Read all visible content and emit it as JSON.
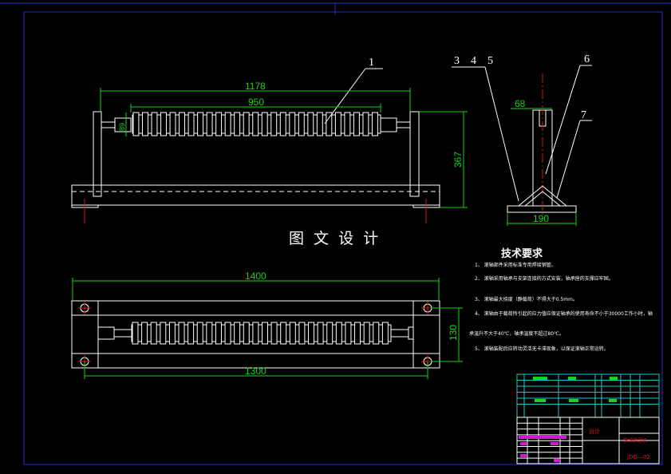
{
  "colors": {
    "background": "#000000",
    "frame": "#2a2ad0",
    "outline": "#ffffff",
    "dimension": "#19d219",
    "centerline": "#d21919",
    "title_block_upper": "#19c8c8",
    "title_text": "#e01919",
    "magenta": "#d019d0"
  },
  "part_labels": [
    "1",
    "3",
    "4",
    "5",
    "6",
    "7"
  ],
  "dimensions": {
    "overall_length": "1178",
    "roller_length": "950",
    "roller_dia": "89",
    "height": "367",
    "post_width": "68",
    "base_width": "190",
    "total_length": "1400",
    "hole_spacing": "1300",
    "rail_spacing": "130"
  },
  "caption": "图 文 设 计",
  "tech": {
    "title": "技术要求",
    "items": [
      "1、 滚轴部件采用标准专用焊接钢管。",
      "2、 滚轴采用轴承与支架连接的方式安装，轴承座的支撑应牢固。",
      "3、 滚轴最大挠度（静载荷）不得大于0.5mm。",
      "4、 滚轴由于载荷所引起的应力值应保证轴承的使用寿命不小于30000工作小时，轴",
      "承温升不大于40℃，轴承温度不超过80℃。",
      "5、 滚轴装配后应转动灵活无卡滞现象，以保证滚轴正常运转。"
    ]
  },
  "title_block": {
    "designer_label": "设计",
    "drawing_name": "滚轴输送机",
    "drawing_number": "JDG—02"
  }
}
